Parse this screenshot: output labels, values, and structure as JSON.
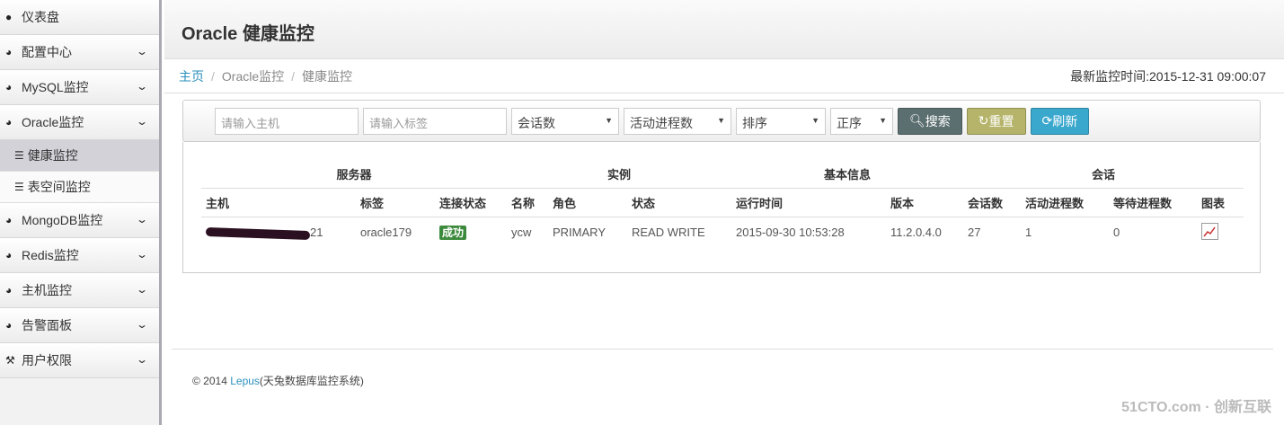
{
  "sidebar": {
    "items": [
      {
        "label": "仪表盘",
        "icon": "comment-icon"
      },
      {
        "label": "配置中心",
        "icon": "dashboard-icon"
      },
      {
        "label": "MySQL监控",
        "icon": "dashboard-icon"
      },
      {
        "label": "Oracle监控",
        "icon": "dashboard-icon"
      },
      {
        "label": "MongoDB监控",
        "icon": "dashboard-icon"
      },
      {
        "label": "Redis监控",
        "icon": "dashboard-icon"
      },
      {
        "label": "主机监控",
        "icon": "dashboard-icon"
      },
      {
        "label": "告警面板",
        "icon": "dashboard-icon"
      },
      {
        "label": "用户权限",
        "icon": "gavel-icon"
      }
    ],
    "sub": [
      "健康监控",
      "表空间监控"
    ]
  },
  "header": {
    "title": "Oracle 健康监控"
  },
  "breadcrumb": {
    "home": "主页",
    "level1": "Oracle监控",
    "level2": "健康监控",
    "time_label": "最新监控时间:2015-12-31 09:00:07"
  },
  "toolbar": {
    "host_placeholder": "请输入主机",
    "tag_placeholder": "请输入标签",
    "sel1": "会话数",
    "sel2": "活动进程数",
    "sel3": "排序",
    "sel4": "正序",
    "search": "搜索",
    "reset": "重置",
    "refresh": "刷新",
    "colors": {
      "search": "#5b6e70",
      "reset": "#b5b46a",
      "refresh": "#3aa7cc"
    }
  },
  "table": {
    "groups": [
      "服务器",
      "实例",
      "基本信息",
      "会话"
    ],
    "headers": [
      "主机",
      "标签",
      "连接状态",
      "名称",
      "角色",
      "状态",
      "运行时间",
      "版本",
      "会话数",
      "活动进程数",
      "等待进程数",
      "图表"
    ],
    "rows": [
      {
        "host": "21",
        "tag": "oracle179",
        "status": "成功",
        "name": "ycw",
        "role": "PRIMARY",
        "state": "READ WRITE",
        "uptime": "2015-09-30 10:53:28",
        "version": "11.2.0.4.0",
        "sessions": "27",
        "active": "1",
        "waiting": "0"
      }
    ]
  },
  "footer": {
    "prefix": "© 2014 ",
    "link": "Lepus",
    "suffix": "(天兔数据库监控系统)"
  },
  "watermark": "51CTO.com 创新互联"
}
